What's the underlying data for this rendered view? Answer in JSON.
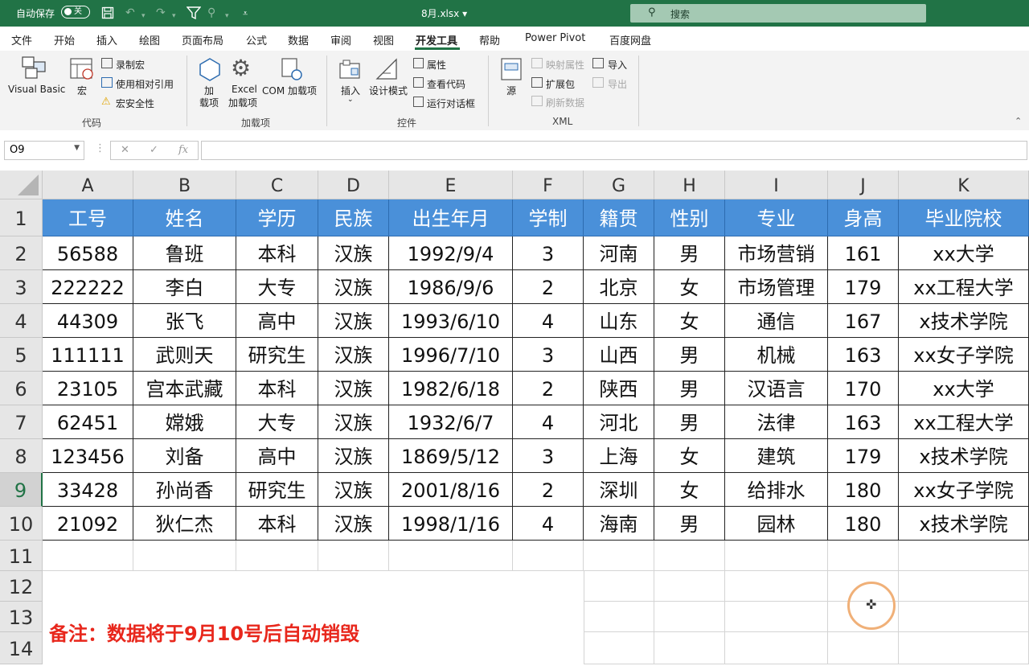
{
  "titlebar": {
    "autosave_label": "自动保存",
    "autosave_state": "关",
    "filename": "8月.xlsx",
    "search_placeholder": "搜索"
  },
  "tabs": [
    "文件",
    "开始",
    "插入",
    "绘图",
    "页面布局",
    "公式",
    "数据",
    "审阅",
    "视图",
    "开发工具",
    "帮助",
    "Power Pivot",
    "百度网盘"
  ],
  "active_tab": "开发工具",
  "ribbon": {
    "code": {
      "group": "代码",
      "visual_basic": "Visual Basic",
      "macros": "宏",
      "record_macro": "录制宏",
      "relative_ref": "使用相对引用",
      "macro_security": "宏安全性"
    },
    "addins": {
      "group": "加载项",
      "addins_line1": "加",
      "addins_line2": "载项",
      "excel_addins_line1": "Excel",
      "excel_addins_line2": "加载项",
      "com_addins": "COM 加载项"
    },
    "controls": {
      "group": "控件",
      "insert": "插入",
      "design_mode": "设计模式",
      "properties": "属性",
      "view_code": "查看代码",
      "run_dialog": "运行对话框"
    },
    "xml": {
      "group": "XML",
      "source": "源",
      "map_properties": "映射属性",
      "expansion_packs": "扩展包",
      "refresh_data": "刷新数据",
      "import": "导入",
      "export": "导出"
    }
  },
  "formula_bar": {
    "name_box": "O9",
    "fx": "fx",
    "value": ""
  },
  "sheet": {
    "columns": [
      "A",
      "B",
      "C",
      "D",
      "E",
      "F",
      "G",
      "H",
      "I",
      "J",
      "K"
    ],
    "rows": [
      "1",
      "2",
      "3",
      "4",
      "5",
      "6",
      "7",
      "8",
      "9",
      "10",
      "11",
      "12",
      "13",
      "14"
    ],
    "selected_row": "9",
    "header": [
      "工号",
      "姓名",
      "学历",
      "民族",
      "出生年月",
      "学制",
      "籍贯",
      "性别",
      "专业",
      "身高",
      "毕业院校"
    ],
    "data": [
      [
        "56588",
        "鲁班",
        "本科",
        "汉族",
        "1992/9/4",
        "3",
        "河南",
        "男",
        "市场营销",
        "161",
        "xx大学"
      ],
      [
        "222222",
        "李白",
        "大专",
        "汉族",
        "1986/9/6",
        "2",
        "北京",
        "女",
        "市场管理",
        "179",
        "xx工程大学"
      ],
      [
        "44309",
        "张飞",
        "高中",
        "汉族",
        "1993/6/10",
        "4",
        "山东",
        "女",
        "通信",
        "167",
        "x技术学院"
      ],
      [
        "111111",
        "武则天",
        "研究生",
        "汉族",
        "1996/7/10",
        "3",
        "山西",
        "男",
        "机械",
        "163",
        "xx女子学院"
      ],
      [
        "23105",
        "宫本武藏",
        "本科",
        "汉族",
        "1982/6/18",
        "2",
        "陕西",
        "男",
        "汉语言",
        "170",
        "xx大学"
      ],
      [
        "62451",
        "嫦娥",
        "大专",
        "汉族",
        "1932/6/7",
        "4",
        "河北",
        "男",
        "法律",
        "163",
        "xx工程大学"
      ],
      [
        "123456",
        "刘备",
        "高中",
        "汉族",
        "1869/5/12",
        "3",
        "上海",
        "女",
        "建筑",
        "179",
        "x技术学院"
      ],
      [
        "33428",
        "孙尚香",
        "研究生",
        "汉族",
        "2001/8/16",
        "2",
        "深圳",
        "女",
        "给排水",
        "180",
        "xx女子学院"
      ],
      [
        "21092",
        "狄仁杰",
        "本科",
        "汉族",
        "1998/1/16",
        "4",
        "海南",
        "男",
        "园林",
        "180",
        "x技术学院"
      ]
    ],
    "note": "备注：数据将于9月10号后自动销毁"
  },
  "colors": {
    "excel_green": "#217346",
    "header_fill": "#4a90d9",
    "note_red": "#e8271c",
    "cursor_ring": "#f0b078"
  }
}
